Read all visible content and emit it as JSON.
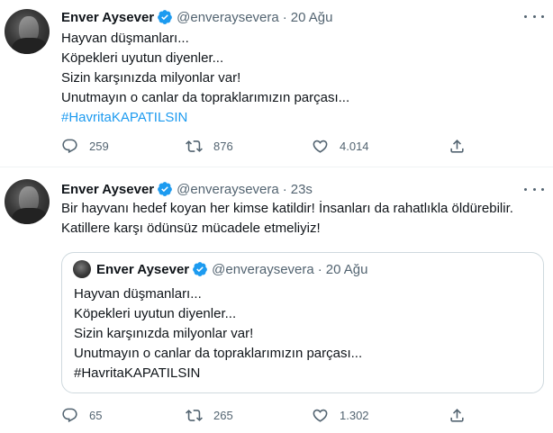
{
  "tweets": [
    {
      "author_name": "Enver Aysever",
      "handle": "@enveraysevera",
      "separator": "·",
      "time": "20 Ağu",
      "lines": [
        "Hayvan düşmanları...",
        "Köpekleri uyutun diyenler...",
        "Sizin karşınızda milyonlar var!",
        "Unutmayın o canlar da topraklarımızın parçası..."
      ],
      "hashtag": "#HavritaKAPATILSIN",
      "replies": "259",
      "retweets": "876",
      "likes": "4.014"
    },
    {
      "author_name": "Enver Aysever",
      "handle": "@enveraysevera",
      "separator": "·",
      "time": "23s",
      "lines": [
        "Bir hayvanı hedef koyan her kimse katildir! İnsanları da rahatlıkla öldürebilir.",
        "Katillere karşı ödünsüz mücadele etmeliyiz!"
      ],
      "replies": "65",
      "retweets": "265",
      "likes": "1.302",
      "quote": {
        "author_name": "Enver Aysever",
        "handle": "@enveraysevera",
        "separator": "·",
        "time": "20 Ağu",
        "lines": [
          "Hayvan düşmanları...",
          "Köpekleri uyutun diyenler...",
          "Sizin karşınızda milyonlar var!",
          "Unutmayın o canlar da topraklarımızın parçası...",
          "#HavritaKAPATILSIN"
        ]
      }
    }
  ],
  "icons": {
    "reply": "reply-icon",
    "retweet": "retweet-icon",
    "like": "like-icon",
    "share": "share-icon",
    "verified": "verified-badge-icon",
    "more": "more-options-icon"
  },
  "colors": {
    "link": "#1d9bf0",
    "secondary_text": "#536471",
    "verified_badge": "#1d9bf0",
    "divider": "#eff3f4",
    "quote_border": "#cfd9de"
  }
}
